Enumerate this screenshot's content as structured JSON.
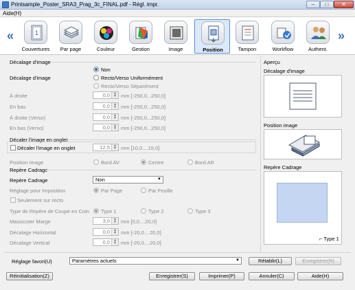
{
  "window": {
    "title": "Printsample_Poster_SRA3_Prag_3c_FINAL.pdf - Régl. impr.",
    "minimize_glyph": "–",
    "maximize_glyph": "□",
    "close_glyph": "✕"
  },
  "menu": {
    "aide": "Aide(H)"
  },
  "toolbar": {
    "nav_left": "«",
    "nav_right": "»",
    "items": [
      {
        "label": "Couvertures",
        "icon": "cover-icon"
      },
      {
        "label": "Par page",
        "icon": "paper-stack-icon"
      },
      {
        "label": "Couleur",
        "icon": "color-icon"
      },
      {
        "label": "Gestion",
        "icon": "management-icon"
      },
      {
        "label": "Image",
        "icon": "image-icon"
      },
      {
        "label": "Position",
        "icon": "position-icon",
        "selected": true
      },
      {
        "label": "Tampon",
        "icon": "stamp-icon"
      },
      {
        "label": "Workflow",
        "icon": "workflow-icon"
      },
      {
        "label": "Authent.",
        "icon": "authentication-icon"
      }
    ]
  },
  "image_shift": {
    "section_title": "Décalage d'image",
    "row_label": "Décalage d'image",
    "options": [
      "Non",
      "Recto/Verso Uniformément",
      "Recto/Verso Séparément"
    ],
    "selected": "Non",
    "fields": [
      {
        "label": "À droite",
        "value": "0,0",
        "unit": "mm [-250,0...250,0]"
      },
      {
        "label": "En bas",
        "value": "0,0",
        "unit": "mm [-250,0...250,0]"
      },
      {
        "label": "À droite (Verso)",
        "value": "0,0",
        "unit": "mm [-250,0...250,0]"
      },
      {
        "label": "En bas (Verso)",
        "value": "0,0",
        "unit": "mm [-250,0...250,0]"
      }
    ]
  },
  "tab_shift": {
    "section_title": "Décaler l'image en onglet",
    "checkbox_label": "Décaler l'image en onglet",
    "value": "12,5",
    "unit": "mm [10,0....15,0]",
    "position_label": "Position image",
    "positions": [
      "Bord AV",
      "Centre",
      "Bord AR"
    ],
    "selected_position": "Centre"
  },
  "crop_marks": {
    "section_title": "Repère Cadrage",
    "row_label": "Repère Cadrage",
    "combo_value": "Non",
    "imposition_label": "Réglage pour Imposition",
    "imposition_options": [
      "Par Page",
      "Par Feuille"
    ],
    "imposition_selected": "Par Page",
    "recto_only_label": "Seulement sur recto",
    "corner_type_label": "Type de Repère de Coupe en Coin",
    "corner_types": [
      "Type 1",
      "Type 2",
      "Type 3"
    ],
    "corner_selected": "Type 1",
    "fields": [
      {
        "label": "Massicoter Marge",
        "value": "3,0",
        "unit": "mm [0,0....20,0]"
      },
      {
        "label": "Décalage Horizontal",
        "value": "0,0",
        "unit": "mm [-20,0....20,0]"
      },
      {
        "label": "Décalage Vertical",
        "value": "0,0",
        "unit": "mm [-20,0....20,0]"
      }
    ]
  },
  "preview": {
    "title": "Aperçu",
    "image_shift_label": "Décalage d'image",
    "position_label": "Position image",
    "crop_label": "Repère Cadrage",
    "crop_type_label": "Type 1"
  },
  "favorites": {
    "label": "Réglage favori(U)",
    "value": "Paramètres actuels",
    "restore_button": "Rétablir(L)",
    "save_button": "Enregistrer(R)"
  },
  "footer": {
    "reset_button": "Réinitialisation(Z)",
    "save_button": "Enregistrer(S)",
    "print_button": "Imprimer(P)",
    "cancel_button": "Annuler(C)",
    "help_button": "Aide(H)"
  },
  "colors": {
    "accent": "#2a64b5",
    "selection": "#dbe9fb",
    "preview_fill": "#c5d6f2"
  }
}
